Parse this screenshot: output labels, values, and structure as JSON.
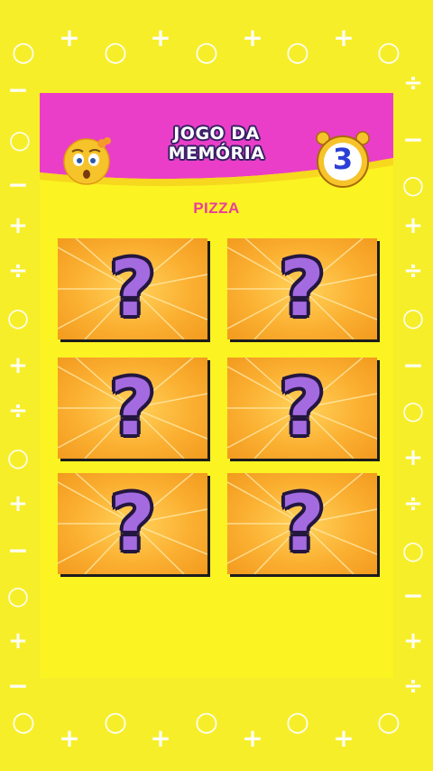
{
  "header": {
    "title_line1": "JOGO DA",
    "title_line2": "MEMÓRIA",
    "timer_value": "3",
    "emoji_icon": "confused-face-emoji"
  },
  "target_word": "PIZZA",
  "cards": [
    {
      "face": "?",
      "state": "face-down"
    },
    {
      "face": "?",
      "state": "face-down"
    },
    {
      "face": "?",
      "state": "face-down"
    },
    {
      "face": "?",
      "state": "face-down"
    },
    {
      "face": "?",
      "state": "face-down"
    },
    {
      "face": "?",
      "state": "face-down"
    }
  ],
  "colors": {
    "background": "#f7ee2a",
    "header": "#ea3ec8",
    "accent_text": "#e83e9c",
    "card": "#fbb032",
    "question_mark": "#a46be0",
    "timer_number": "#2a3fd6"
  }
}
